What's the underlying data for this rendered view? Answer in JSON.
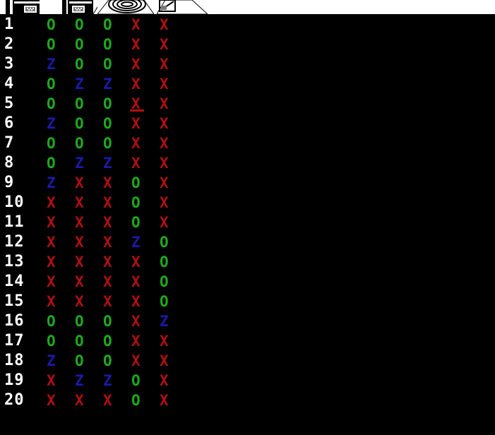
{
  "toolbar": {
    "icons": [
      "table-save-icon",
      "table-load-icon",
      "cd-drive-icon",
      "eraser-icon"
    ]
  },
  "grid": {
    "row_labels": [
      "1",
      "2",
      "3",
      "4",
      "5",
      "6",
      "7",
      "8",
      "9",
      "10",
      "11",
      "12",
      "13",
      "14",
      "15",
      "16",
      "17",
      "18",
      "19",
      "20"
    ],
    "rows": [
      [
        "O",
        "O",
        "O",
        "X",
        "X"
      ],
      [
        "O",
        "O",
        "O",
        "X",
        "X"
      ],
      [
        "Z",
        "O",
        "O",
        "X",
        "X"
      ],
      [
        "O",
        "Z",
        "Z",
        "X",
        "X"
      ],
      [
        "O",
        "O",
        "O",
        "X",
        "X"
      ],
      [
        "Z",
        "O",
        "O",
        "X",
        "X"
      ],
      [
        "O",
        "O",
        "O",
        "X",
        "X"
      ],
      [
        "O",
        "Z",
        "Z",
        "X",
        "X"
      ],
      [
        "Z",
        "X",
        "X",
        "O",
        "X"
      ],
      [
        "X",
        "X",
        "X",
        "O",
        "X"
      ],
      [
        "X",
        "X",
        "X",
        "O",
        "X"
      ],
      [
        "X",
        "X",
        "X",
        "Z",
        "O"
      ],
      [
        "X",
        "X",
        "X",
        "X",
        "O"
      ],
      [
        "X",
        "X",
        "X",
        "X",
        "O"
      ],
      [
        "X",
        "X",
        "X",
        "X",
        "O"
      ],
      [
        "O",
        "O",
        "O",
        "X",
        "Z"
      ],
      [
        "O",
        "O",
        "O",
        "X",
        "X"
      ],
      [
        "Z",
        "O",
        "O",
        "X",
        "X"
      ],
      [
        "X",
        "Z",
        "Z",
        "O",
        "X"
      ],
      [
        "X",
        "X",
        "X",
        "O",
        "X"
      ]
    ],
    "cursor": {
      "row": 5,
      "col": 4
    },
    "colors": {
      "O": "#1ea81e",
      "Z": "#1a1aa8",
      "X": "#b01010",
      "row_label": "#ffffff",
      "background": "#000000"
    }
  }
}
